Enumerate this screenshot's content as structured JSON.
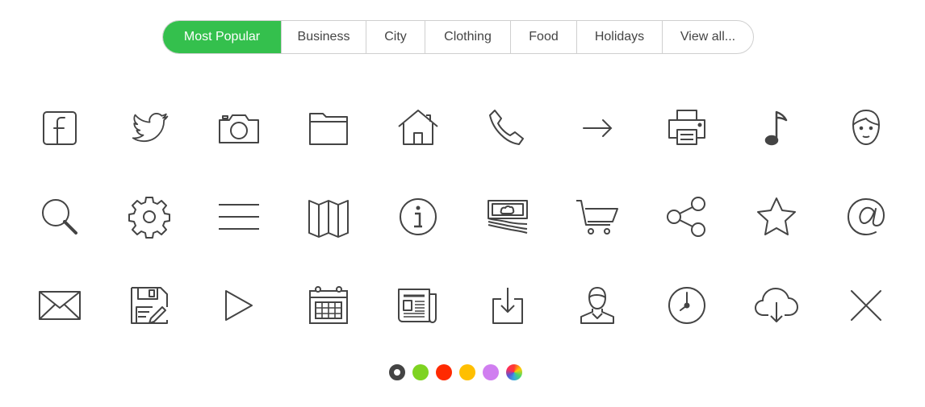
{
  "tabs": [
    {
      "label": "Most Popular",
      "active": true
    },
    {
      "label": "Business",
      "active": false
    },
    {
      "label": "City",
      "active": false
    },
    {
      "label": "Clothing",
      "active": false
    },
    {
      "label": "Food",
      "active": false
    },
    {
      "label": "Holidays",
      "active": false
    },
    {
      "label": "View all...",
      "active": false
    }
  ],
  "accent_color": "#34c04d",
  "icon_color": "#444444",
  "icons": [
    "facebook-icon",
    "twitter-icon",
    "camera-icon",
    "folder-icon",
    "home-icon",
    "phone-icon",
    "arrow-right-icon",
    "printer-icon",
    "music-note-icon",
    "user-face-icon",
    "search-icon",
    "gear-icon",
    "menu-icon",
    "map-icon",
    "info-icon",
    "money-icon",
    "shopping-cart-icon",
    "share-icon",
    "star-icon",
    "at-sign-icon",
    "envelope-icon",
    "save-edit-icon",
    "play-icon",
    "calendar-icon",
    "newspaper-icon",
    "download-icon",
    "user-icon",
    "clock-icon",
    "cloud-download-icon",
    "close-icon"
  ],
  "swatches": [
    {
      "name": "dark-gray",
      "color": "#444444",
      "selected": true
    },
    {
      "name": "green",
      "color": "#7ed321",
      "selected": false
    },
    {
      "name": "red",
      "color": "#ff2a00",
      "selected": false
    },
    {
      "name": "yellow",
      "color": "#ffbf00",
      "selected": false
    },
    {
      "name": "purple",
      "color": "#d07ef0",
      "selected": false
    },
    {
      "name": "multicolor",
      "color": "conic-gradient(#ff3b30,#ffcc00,#4cd964,#34aadc,#5856d6,#ff2d55,#ff3b30)",
      "selected": false
    }
  ]
}
